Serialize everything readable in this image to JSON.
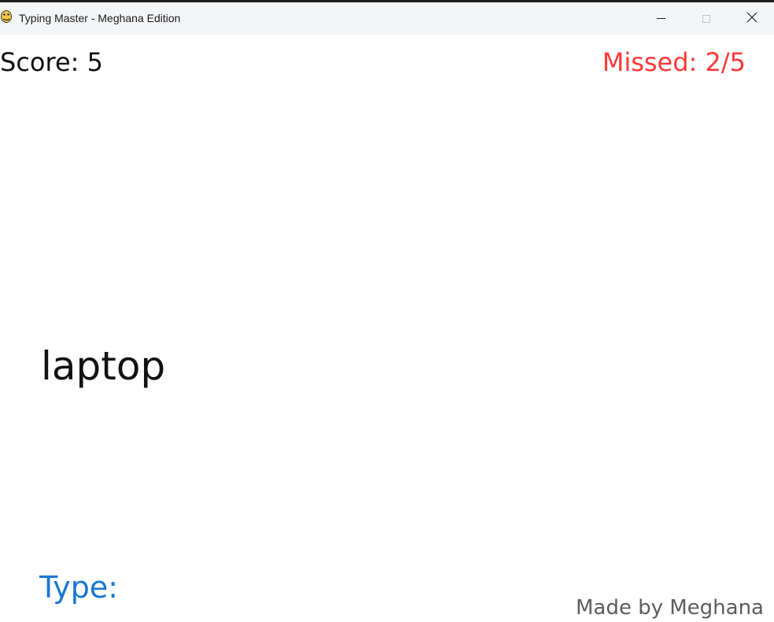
{
  "window": {
    "title": "Typing Master - Meghana Edition",
    "app_icon": "pygame-snake-icon",
    "controls": {
      "minimize_icon": "minimize-icon",
      "maximize_icon": "maximize-icon",
      "close_icon": "close-icon"
    }
  },
  "game": {
    "score_text": "Score: 5",
    "missed_text": "Missed: 2/5",
    "current_word": "laptop",
    "type_label": "Type:",
    "typed_value": "",
    "credit": "Made by Meghana"
  },
  "colors": {
    "score": "#111111",
    "missed": "#ff3838",
    "type_label": "#1877d2",
    "credit": "#5d5d5d",
    "background": "#ffffff"
  }
}
